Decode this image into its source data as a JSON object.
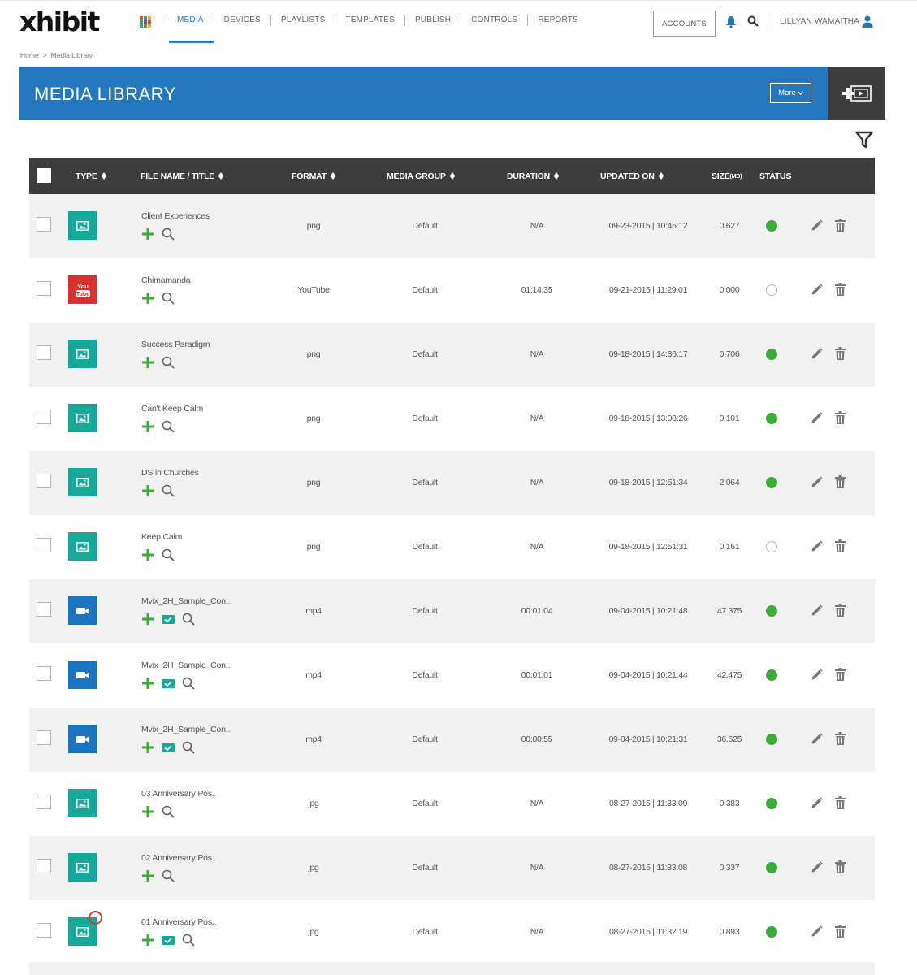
{
  "app": {
    "logo": "xhibit",
    "nav": [
      "MEDIA",
      "DEVICES",
      "PLAYLISTS",
      "TEMPLATES",
      "PUBLISH",
      "CONTROLS",
      "REPORTS"
    ],
    "accounts_label": "ACCOUNTS",
    "username": "LILLYAN WAMAITHA",
    "grid_colors": [
      "#e84c3d",
      "#2d9bd9",
      "#f3b21d",
      "#3cab3a",
      "#8e44ad",
      "#e84c3d",
      "#2d9bd9",
      "#3cab3a",
      "#f3b21d"
    ]
  },
  "breadcrumb": {
    "home": "Home",
    "separator": ">",
    "current": "Media Library"
  },
  "header": {
    "title": "MEDIA  LIBRARY",
    "more_label": "More"
  },
  "table": {
    "columns": {
      "type": "TYPE",
      "file_name": "FILE NAME / TITLE",
      "format": "FORMAT",
      "media_group": "MEDIA GROUP",
      "duration": "DURATION",
      "updated_on": "UPDATED ON",
      "size": "SIZE",
      "size_unit": "(MB)",
      "status": "STATUS"
    },
    "rows": [
      {
        "name": "Client Experiences",
        "type": "image",
        "format": "png",
        "group": "Default",
        "duration": "N/A",
        "updated": "09-23-2015  |  10:45:12",
        "size": "0.627",
        "status": "active",
        "preview": false
      },
      {
        "name": "Chimamanda",
        "type": "youtube",
        "format": "YouTube",
        "group": "Default",
        "duration": "01:14:35",
        "updated": "09-21-2015  |  11:29:01",
        "size": "0.000",
        "status": "inactive",
        "preview": false
      },
      {
        "name": "Success Paradigm",
        "type": "image",
        "format": "png",
        "group": "Default",
        "duration": "N/A",
        "updated": "09-18-2015  |  14:36:17",
        "size": "0.706",
        "status": "active",
        "preview": false
      },
      {
        "name": "Can't Keep Calm",
        "type": "image",
        "format": "png",
        "group": "Default",
        "duration": "N/A",
        "updated": "09-18-2015  |  13:08:26",
        "size": "0.101",
        "status": "active",
        "preview": false
      },
      {
        "name": "DS in Churches",
        "type": "image",
        "format": "png",
        "group": "Default",
        "duration": "N/A",
        "updated": "09-18-2015  |  12:51:34",
        "size": "2.064",
        "status": "active",
        "preview": false
      },
      {
        "name": "Keep Calm",
        "type": "image",
        "format": "png",
        "group": "Default",
        "duration": "N/A",
        "updated": "09-18-2015  |  12:51:31",
        "size": "0.161",
        "status": "inactive",
        "preview": false
      },
      {
        "name": "Mvix_2H_Sample_Con..",
        "type": "video",
        "format": "mp4",
        "group": "Default",
        "duration": "00:01:04",
        "updated": "09-04-2015  |  10:21:48",
        "size": "47.375",
        "status": "active",
        "preview": true
      },
      {
        "name": "Mvix_2H_Sample_Con..",
        "type": "video",
        "format": "mp4",
        "group": "Default",
        "duration": "00:01:01",
        "updated": "09-04-2015  |  10:21:44",
        "size": "42.475",
        "status": "active",
        "preview": true
      },
      {
        "name": "Mvix_2H_Sample_Con..",
        "type": "video",
        "format": "mp4",
        "group": "Default",
        "duration": "00:00:55",
        "updated": "09-04-2015  |  10:21:31",
        "size": "36.625",
        "status": "active",
        "preview": true
      },
      {
        "name": "03 Anniversary Pos..",
        "type": "image",
        "format": "jpg",
        "group": "Default",
        "duration": "N/A",
        "updated": "08-27-2015  |  11:33:09",
        "size": "0.383",
        "status": "active",
        "preview": false
      },
      {
        "name": "02 Anniversary Pos..",
        "type": "image",
        "format": "jpg",
        "group": "Default",
        "duration": "N/A",
        "updated": "08-27-2015  |  11:33:08",
        "size": "0.337",
        "status": "active",
        "preview": false
      },
      {
        "name": "01 Anniversary Pos..",
        "type": "image",
        "format": "jpg",
        "group": "Default",
        "duration": "N/A",
        "updated": "08-27-2015  |  11:32:19",
        "size": "0.893",
        "status": "active",
        "preview": true,
        "badge": true
      }
    ]
  },
  "colors": {
    "brand_blue": "#2577be",
    "dark_header": "#3d3d3d",
    "image_teal": "#16a99a",
    "video_blue": "#1b74c0",
    "youtube_red": "#d8322e",
    "status_green": "#3cab3a",
    "action_green": "#3cab3a"
  },
  "icons": {
    "image_type": "image-icon",
    "video_type": "video-camera-icon",
    "youtube_type": "youtube-icon",
    "add": "plus-icon",
    "preview": "preview-icon",
    "search": "search-icon",
    "edit": "pencil-icon",
    "delete": "trash-icon",
    "filter": "filter-icon"
  }
}
